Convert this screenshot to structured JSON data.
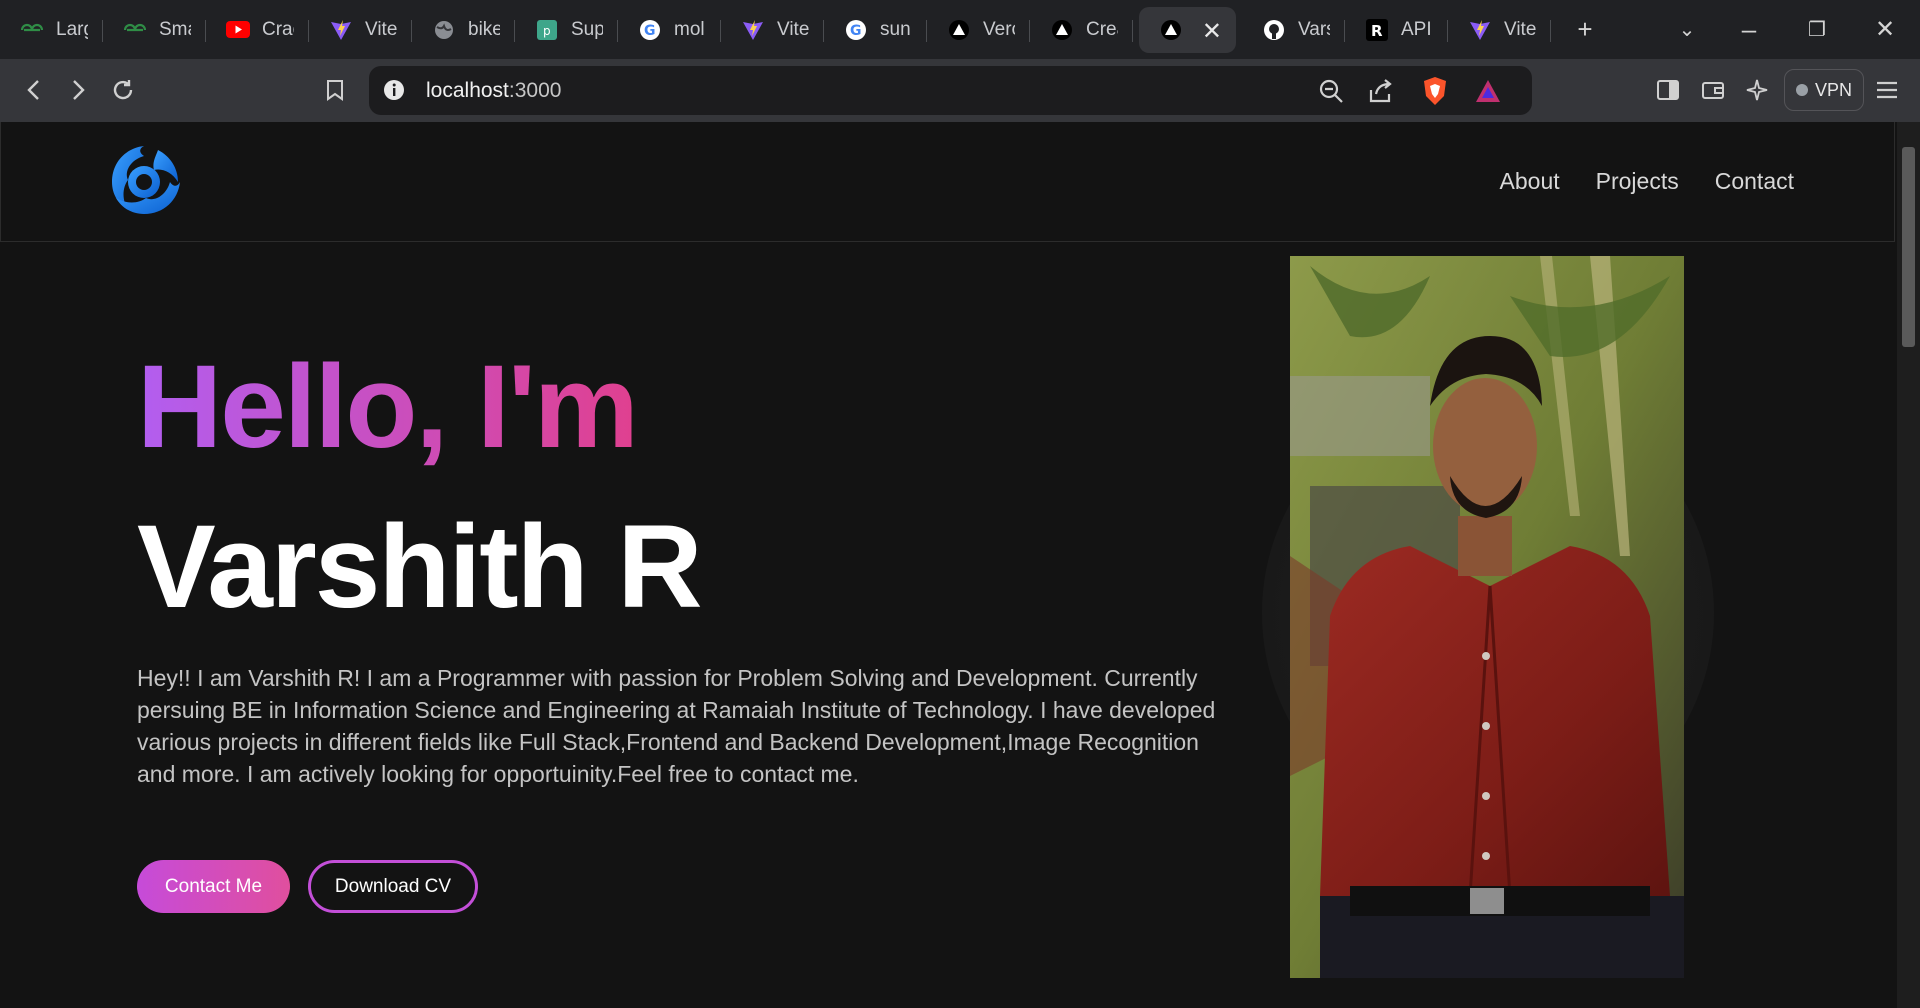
{
  "browser": {
    "tabs": [
      {
        "title": "Larg",
        "icon": "geeksforgeeks-icon"
      },
      {
        "title": "Sma",
        "icon": "geeksforgeeks-icon"
      },
      {
        "title": "Crac",
        "icon": "youtube-icon"
      },
      {
        "title": "Vite",
        "icon": "vite-icon"
      },
      {
        "title": "bike",
        "icon": "globe-icon"
      },
      {
        "title": "Sup",
        "icon": "pdf-icon"
      },
      {
        "title": "mol",
        "icon": "google-icon"
      },
      {
        "title": "Vite",
        "icon": "vite-icon"
      },
      {
        "title": "sun",
        "icon": "google-icon"
      },
      {
        "title": "Verc",
        "icon": "vercel-icon"
      },
      {
        "title": "Crea",
        "icon": "vercel-icon"
      },
      {
        "title": "",
        "icon": "vercel-icon",
        "active": true
      },
      {
        "title": "Vars",
        "icon": "github-icon"
      },
      {
        "title": "API",
        "icon": "r-icon"
      },
      {
        "title": "Vite",
        "icon": "vite-icon"
      }
    ],
    "url_host": "localhost",
    "url_port": ":3000",
    "vpn_label": "VPN"
  },
  "nav": {
    "links": [
      "About",
      "Projects",
      "Contact"
    ]
  },
  "hero": {
    "greeting": "Hello, I'm",
    "name": "Varshith R",
    "bio": "Hey!! I am Varshith R! I am a Programmer with passion for Problem Solving and Development. Currently persuing BE in Information Science and Engineering at Ramaiah Institute of Technology. I have developed various projects in different fields like Full Stack,Frontend and Backend Development,Image Recognition and more. I am actively looking for opportuinity.Feel free to contact me.",
    "contact_button": "Contact Me",
    "cv_button": "Download CV"
  },
  "colors": {
    "accent_start": "#b25ef0",
    "accent_end": "#e0408f",
    "background": "#131313"
  }
}
